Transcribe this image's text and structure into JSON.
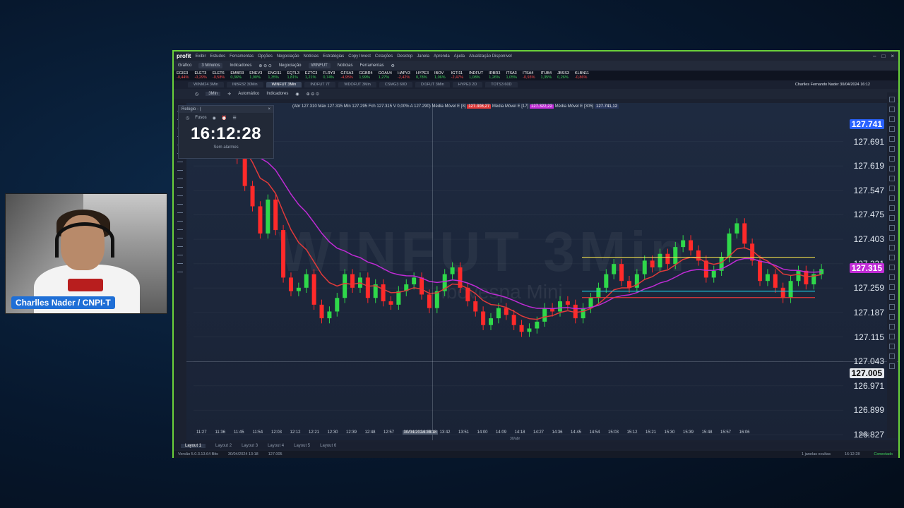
{
  "webcam": {
    "label": "Charlles Nader / CNPI-T"
  },
  "titlebar": {
    "logo": "profit",
    "menu": [
      "Exibir",
      "Estudos",
      "Ferramentas",
      "Opções",
      "Negociação",
      "Notícias",
      "Estratégias",
      "Copy Invest",
      "Cotações",
      "Desktop",
      "Janela",
      "Aprenda",
      "Ajuda",
      "Atualização Disponível"
    ]
  },
  "toolbar1": {
    "grafico": "Gráfico",
    "interval": "3 Minutos",
    "indicadores": "Indicadores",
    "negociacao": "Negociação",
    "symbol": "WINFUT",
    "noticias": "Notícias",
    "ferramentas": "Ferramentas"
  },
  "ticker": [
    {
      "name": "EGIE3",
      "v": "-0,44%",
      "c": "dn"
    },
    {
      "name": "ELET3",
      "v": "-0,29%",
      "c": "dn"
    },
    {
      "name": "ELET6",
      "v": "-0,58%",
      "c": "dn"
    },
    {
      "name": "EMBR3",
      "v": "0,36%",
      "c": "up"
    },
    {
      "name": "ENEV3",
      "v": "1,90%",
      "c": "up"
    },
    {
      "name": "ENGI11",
      "v": "1,35%",
      "c": "up"
    },
    {
      "name": "EQTL3",
      "v": "1,81%",
      "c": "up"
    },
    {
      "name": "EZTC3",
      "v": "1,21%",
      "c": "up"
    },
    {
      "name": "FLRY3",
      "v": "0,74%",
      "c": "up"
    },
    {
      "name": "GFSA3",
      "v": "-4,95%",
      "c": "dn"
    },
    {
      "name": "GGBR4",
      "v": "1,99%",
      "c": "up"
    },
    {
      "name": "GOAU4",
      "v": "1,27%",
      "c": "up"
    },
    {
      "name": "HAPV3",
      "v": "-2,42%",
      "c": "dn"
    },
    {
      "name": "HYPE3",
      "v": "0,78%",
      "c": "up"
    },
    {
      "name": "IBOV",
      "v": "1,06%",
      "c": "up"
    },
    {
      "name": "IGTI11",
      "v": "-2,47%",
      "c": "dn"
    },
    {
      "name": "INDFUT",
      "v": "1,08%",
      "c": "up"
    },
    {
      "name": "IRBR3",
      "v": "1,26%",
      "c": "up"
    },
    {
      "name": "ITSA3",
      "v": "1,05%",
      "c": "up"
    },
    {
      "name": "ITSA4",
      "v": "-0,93%",
      "c": "dn"
    },
    {
      "name": "ITUB4",
      "v": "1,35%",
      "c": "up"
    },
    {
      "name": "JBSS3",
      "v": "0,26%",
      "c": "up"
    },
    {
      "name": "KLBN11",
      "v": "-0,86%",
      "c": "dn"
    }
  ],
  "tabs": [
    "WINM24 3Min",
    "INBR32 30Min",
    "WINFUT 3Min",
    "INDFUT 7T",
    "WDOFUT 3Min",
    "CSMG3 60D",
    "DI1FUT 3Min",
    "HYPE3 2D",
    "TOTS3 60D"
  ],
  "user": "Charlles Fernando Nader   30/04/2024 16:12",
  "toolbar2": {
    "interval": "3Min",
    "mode": "Automático",
    "indicadores": "Indicadores"
  },
  "legend": {
    "ohlc": "(Abr 127.310 Máx 127.315 Mín 127.295 Fch 127.315 V 0,00% A 127.290)",
    "ma1_label": "Média Móvel E [8]",
    "ma1_val": "127.308,27",
    "ma2_label": "Média Móvel E [17]",
    "ma2_val": "127.322,22",
    "ma3_label": "Média Móvel E [305]",
    "ma3_val": "127.741,12"
  },
  "clock": {
    "title": "Relógio - (",
    "fuso": "Fusos",
    "time": "16:12:28",
    "alarm": "Sem alarmes"
  },
  "watermark": {
    "symbol": "WINFUT 3Min",
    "name": "Ibovespa Mini"
  },
  "chart_data": {
    "type": "candlestick",
    "y_ticks": [
      "127.691",
      "127.619",
      "127.547",
      "127.475",
      "127.403",
      "127.331",
      "127.259",
      "127.187",
      "127.115",
      "127.043",
      "126.971",
      "126.899",
      "126.827"
    ],
    "ylim": [
      126.827,
      127.763
    ],
    "price_tags": [
      {
        "value": "127.315",
        "color": "#ffffff",
        "bg": "#c02bd6"
      },
      {
        "value": "127.005",
        "color": "#000000",
        "bg": "#e6e9ee"
      },
      {
        "value": "127.741",
        "color": "#ffffff",
        "bg": "#2962ff"
      }
    ],
    "x_ticks": [
      "11:27",
      "11:36",
      "11:45",
      "11:54",
      "12:03",
      "12:12",
      "12:21",
      "12:30",
      "12:39",
      "12:48",
      "12:57",
      "30/04/2024 13:18",
      "13:33",
      "13:42",
      "13:51",
      "14:00",
      "14:09",
      "14:18",
      "14:27",
      "14:36",
      "14:45",
      "14:54",
      "15:03",
      "15:12",
      "15:21",
      "15:30",
      "15:39",
      "15:48",
      "15:57",
      "16:06"
    ],
    "date_label": "30/abr",
    "closes": [
      127.72,
      127.69,
      127.64,
      127.56,
      127.5,
      127.42,
      127.52,
      127.43,
      127.29,
      127.25,
      127.26,
      127.3,
      127.21,
      127.17,
      127.19,
      127.23,
      127.3,
      127.26,
      127.29,
      127.23,
      127.27,
      127.22,
      127.21,
      127.25,
      127.27,
      127.29,
      127.24,
      127.2,
      127.25,
      127.3,
      127.32,
      127.26,
      127.22,
      127.19,
      127.15,
      127.17,
      127.2,
      127.18,
      127.15,
      127.13,
      127.14,
      127.16,
      127.2,
      127.19,
      127.22,
      127.21,
      127.17,
      127.2,
      127.23,
      127.26,
      127.3,
      127.33,
      127.28,
      127.26,
      127.3,
      127.34,
      127.32,
      127.36,
      127.33,
      127.38,
      127.4,
      127.37,
      127.34,
      127.29,
      127.31,
      127.35,
      127.42,
      127.45,
      127.39,
      127.34,
      127.28,
      127.3,
      127.26,
      127.23,
      127.28,
      127.31,
      127.27,
      127.3,
      127.315
    ],
    "ma_fast_color": "#e13a3a",
    "ma_mid_color": "#c02bd6",
    "levels": [
      {
        "value": 127.25,
        "color": "#1ec8d8"
      },
      {
        "value": 127.231,
        "color": "#e13a3a"
      },
      {
        "value": 127.35,
        "color": "#e8d84a"
      }
    ]
  },
  "right_axis_time": "02:32",
  "layouts": [
    "Layout 1",
    "Layout 2",
    "Layout 3",
    "Layout 4",
    "Layout 5",
    "Layout 6"
  ],
  "status": {
    "version": "Versão 5.0.3.13.64 Bits",
    "date": "30/04/2024 13:18",
    "price": "127.005",
    "windows": "1 janelas ocultas",
    "time": "16:12:28",
    "conn": "Conectado"
  }
}
